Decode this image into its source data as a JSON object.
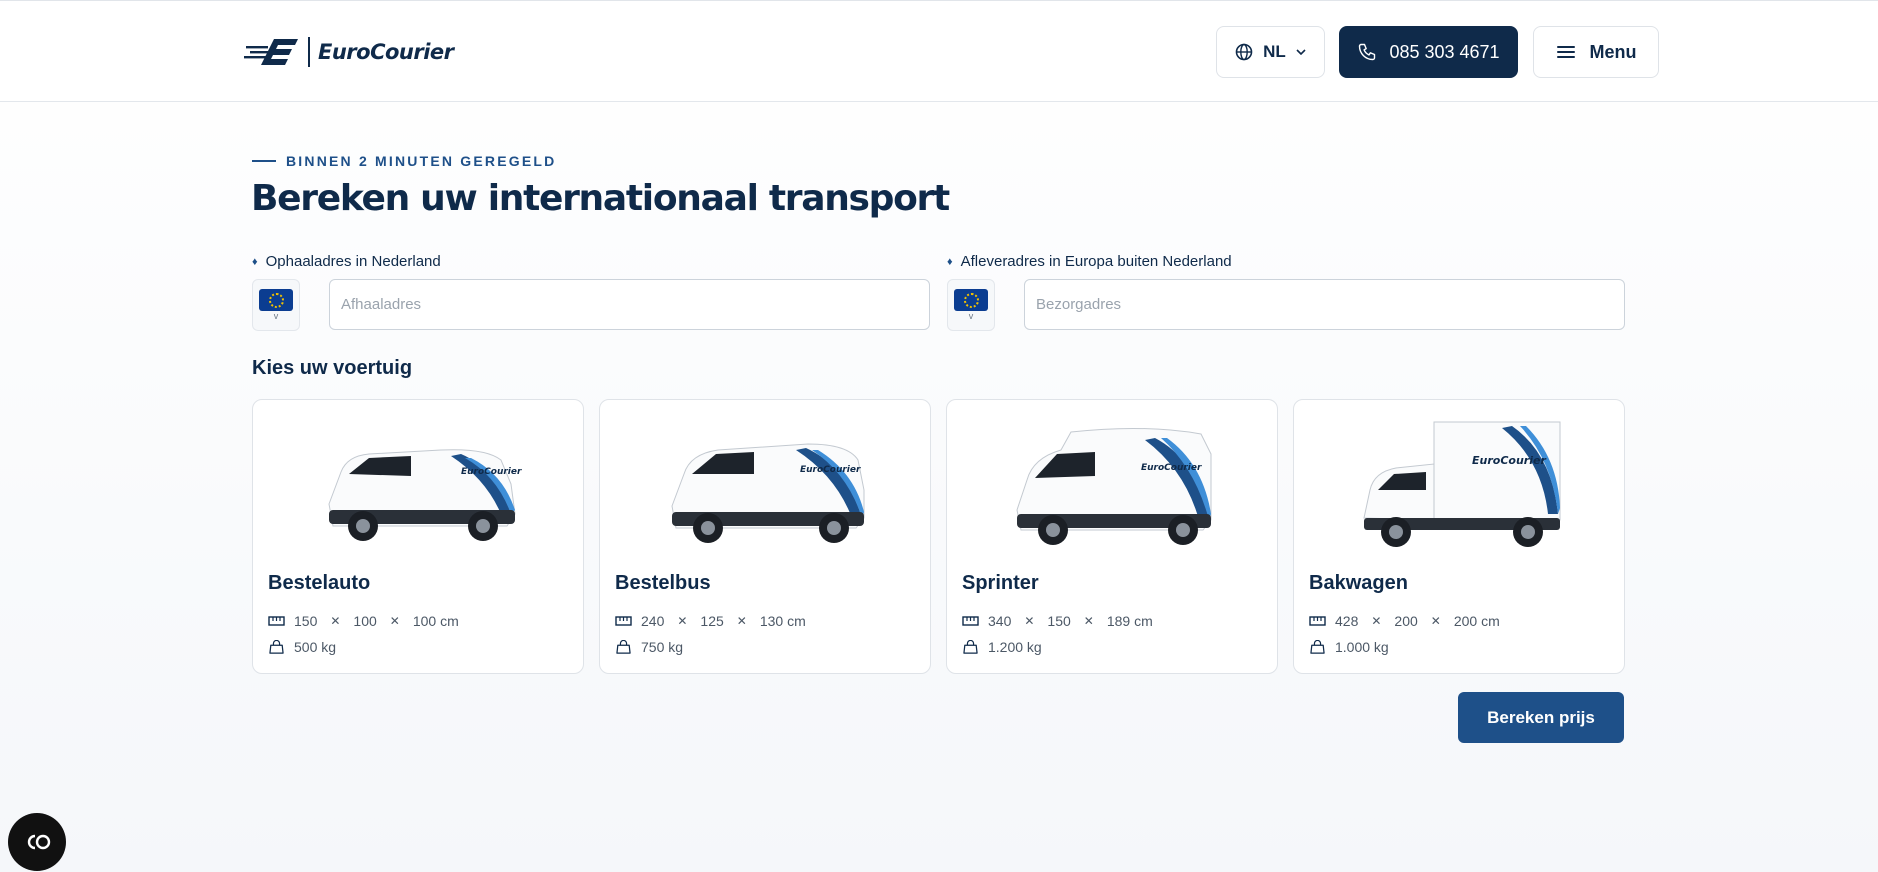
{
  "header": {
    "logo_text": "EuroCourier",
    "language": "NL",
    "phone": "085 303 4671",
    "menu_label": "Menu"
  },
  "hero": {
    "eyebrow": "BINNEN 2 MINUTEN GEREGELD",
    "title": "Bereken uw internationaal transport"
  },
  "pickup": {
    "label": "Ophaaladres in Nederland",
    "placeholder": "Afhaaladres",
    "value": ""
  },
  "delivery": {
    "label": "Afleveradres in Europa buiten Nederland",
    "placeholder": "Bezorgadres",
    "value": ""
  },
  "vehicles": {
    "section_title": "Kies uw voertuig",
    "items": [
      {
        "name": "Bestelauto",
        "length": "150",
        "width": "100",
        "height": "100 cm",
        "weight": "500 kg"
      },
      {
        "name": "Bestelbus",
        "length": "240",
        "width": "125",
        "height": "130 cm",
        "weight": "750 kg"
      },
      {
        "name": "Sprinter",
        "length": "340",
        "width": "150",
        "height": "189 cm",
        "weight": "1.200 kg"
      },
      {
        "name": "Bakwagen",
        "length": "428",
        "width": "200",
        "height": "200 cm",
        "weight": "1.000 kg"
      }
    ]
  },
  "cta": {
    "label": "Bereken prijs"
  },
  "colors": {
    "brand_navy": "#0f2a4a",
    "brand_blue": "#1e5089",
    "accent_light_blue": "#3f8fd8"
  },
  "icons": {
    "globe": "globe-icon",
    "chevron": "chevron-down-icon",
    "phone": "phone-icon",
    "menu": "hamburger-icon",
    "ruler": "ruler-icon",
    "weight": "weight-icon",
    "cookie": "cookie-settings-icon"
  }
}
